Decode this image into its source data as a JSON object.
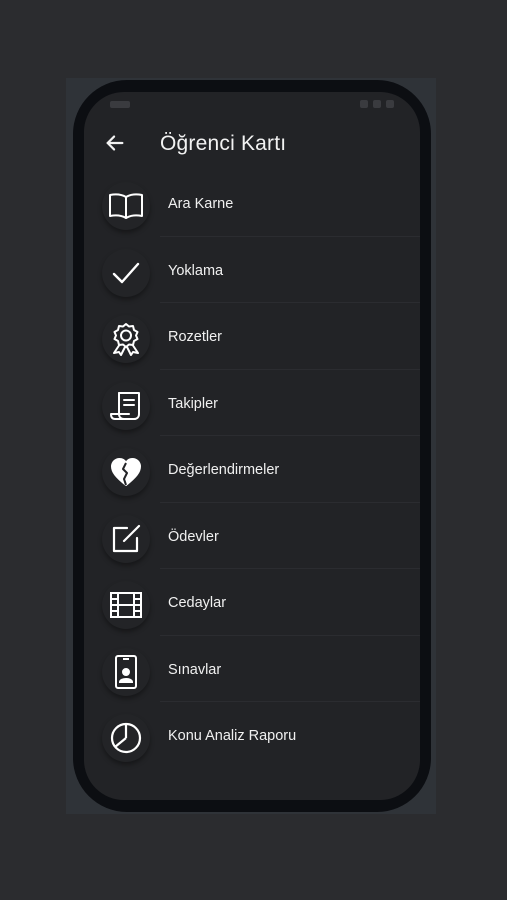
{
  "header": {
    "title": "Öğrenci Kartı",
    "back_icon": "arrow-left-icon"
  },
  "menu": {
    "items": [
      {
        "label": "Ara Karne",
        "icon": "open-book-icon"
      },
      {
        "label": "Yoklama",
        "icon": "checkmark-icon"
      },
      {
        "label": "Rozetler",
        "icon": "award-ribbon-icon"
      },
      {
        "label": "Takipler",
        "icon": "receipt-icon"
      },
      {
        "label": "Değerlendirmeler",
        "icon": "heart-half-icon"
      },
      {
        "label": "Ödevler",
        "icon": "edit-square-icon"
      },
      {
        "label": "Cedaylar",
        "icon": "film-icon"
      },
      {
        "label": "Sınavlar",
        "icon": "phone-profile-icon"
      },
      {
        "label": "Konu Analiz Raporu",
        "icon": "pie-chart-icon"
      }
    ]
  },
  "colors": {
    "background": "#2b2c2f",
    "screen": "#222326",
    "phone_frame": "#0c0e12",
    "text": "#f0f0f0"
  }
}
